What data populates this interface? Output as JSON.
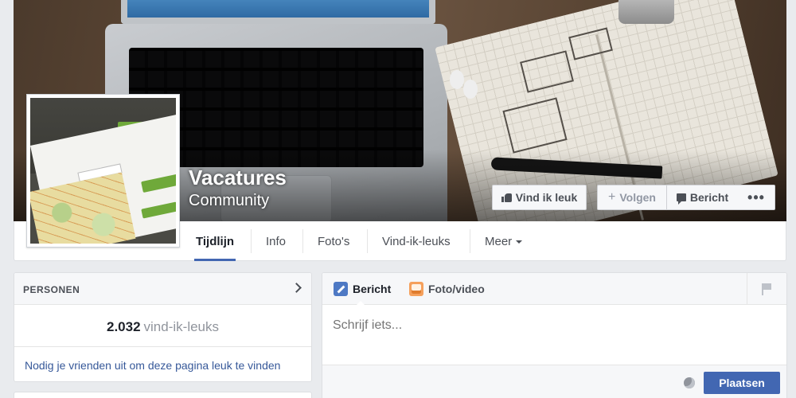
{
  "page": {
    "name": "Vacatures",
    "category": "Community"
  },
  "actions": {
    "like_label": "Vind ik leuk",
    "follow_label": "Volgen",
    "message_label": "Bericht",
    "more_label": "•••"
  },
  "nav": {
    "tabs": [
      {
        "label": "Tijdlijn",
        "active": true
      },
      {
        "label": "Info"
      },
      {
        "label": "Foto's"
      },
      {
        "label": "Vind-ik-leuks"
      },
      {
        "label": "Meer"
      }
    ]
  },
  "people": {
    "title": "PERSONEN",
    "likes_count": "2.032",
    "likes_label": "vind-ik-leuks",
    "invite_text": "Nodig je vrienden uit om deze pagina leuk te vinden"
  },
  "composer": {
    "tabs": [
      {
        "label": "Bericht",
        "icon": "pencil-icon"
      },
      {
        "label": "Foto/video",
        "icon": "photo-icon"
      }
    ],
    "placeholder": "Schrijf iets...",
    "post_label": "Plaatsen"
  },
  "colors": {
    "brand_blue": "#4267b2",
    "link_blue": "#365899",
    "page_bg": "#e9ebee"
  }
}
